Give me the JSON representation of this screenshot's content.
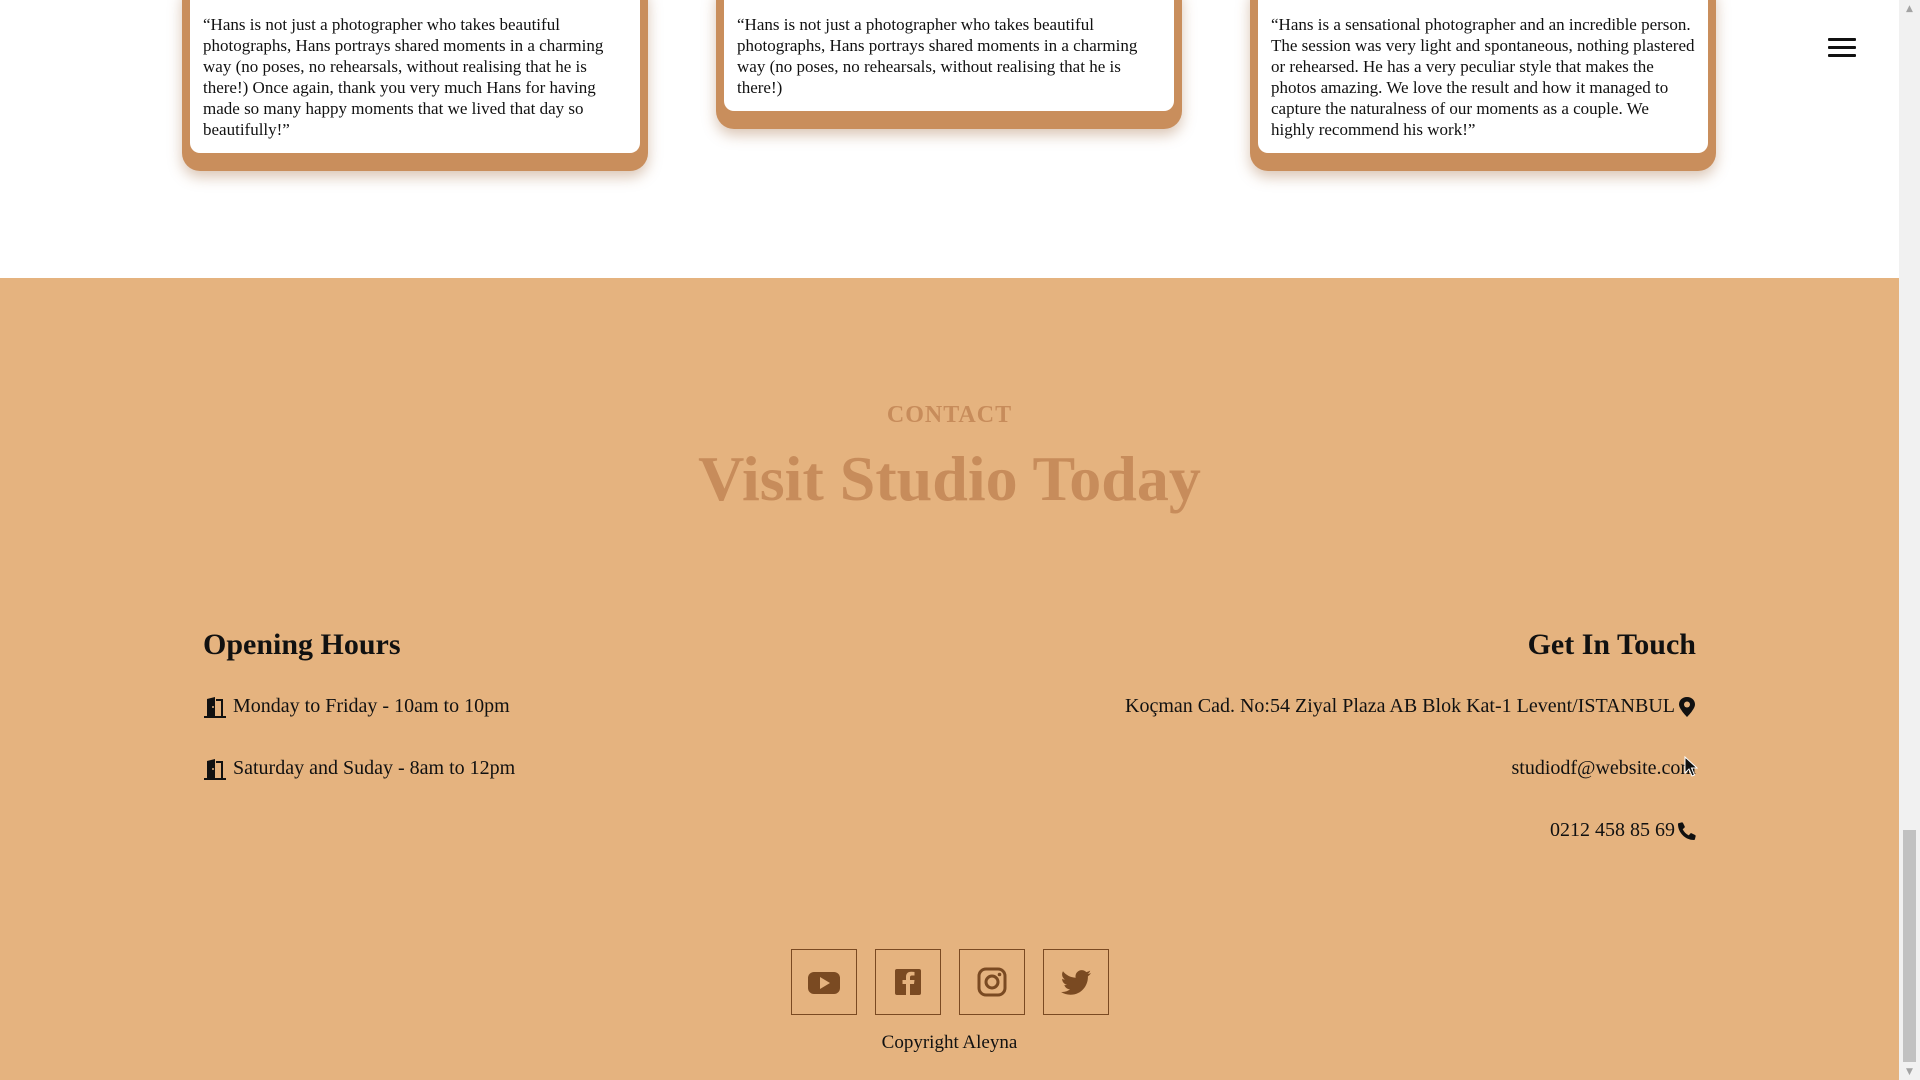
{
  "testimonials": [
    {
      "quote": "“Hans is not just a photographer who takes beautiful photographs, Hans portrays shared moments in a charming way (no poses, no rehearsals, without realising that he is there!) Once again, thank you very much Hans for having made so many happy moments that we lived that day so beautifully!”"
    },
    {
      "quote": "“Hans is not just a photographer who takes beautiful photographs, Hans portrays shared moments in a charming way (no poses, no rehearsals, without realising that he is there!)"
    },
    {
      "quote": "“Hans is a sensational photographer and an incredible person. The session was very light and spontaneous, nothing plastered or rehearsed. He has a very peculiar style that makes the photos amazing. We love the result and how it managed to capture the naturalness of our moments as a couple. We highly recommend his work!”"
    }
  ],
  "nav": {
    "menu_icon": "hamburger-menu-icon"
  },
  "contact": {
    "eyebrow": "CONTACT",
    "headline": "Visit Studio Today",
    "opening_hours": {
      "title": "Opening Hours",
      "rows": [
        {
          "icon": "door-open-icon",
          "text": "Monday to Friday - 10am to 10pm"
        },
        {
          "icon": "door-open-icon",
          "text": "Saturday and Suday - 8am to 12pm"
        }
      ]
    },
    "get_in_touch": {
      "title": "Get In Touch",
      "address": "Koçman Cad. No:54 Ziyal Plaza AB Blok Kat-1 Levent/ISTANBUL",
      "email": "studiodf@website.com",
      "phone": "0212 458 85 69"
    }
  },
  "socials": [
    "youtube-icon",
    "facebook-icon",
    "instagram-icon",
    "twitter-icon"
  ],
  "footer": {
    "copyright": "Copyright Aleyna"
  },
  "colors": {
    "footer_bg": "#e5b37f",
    "accent": "#c78c5b",
    "card_shadow": "#c98e5c"
  }
}
